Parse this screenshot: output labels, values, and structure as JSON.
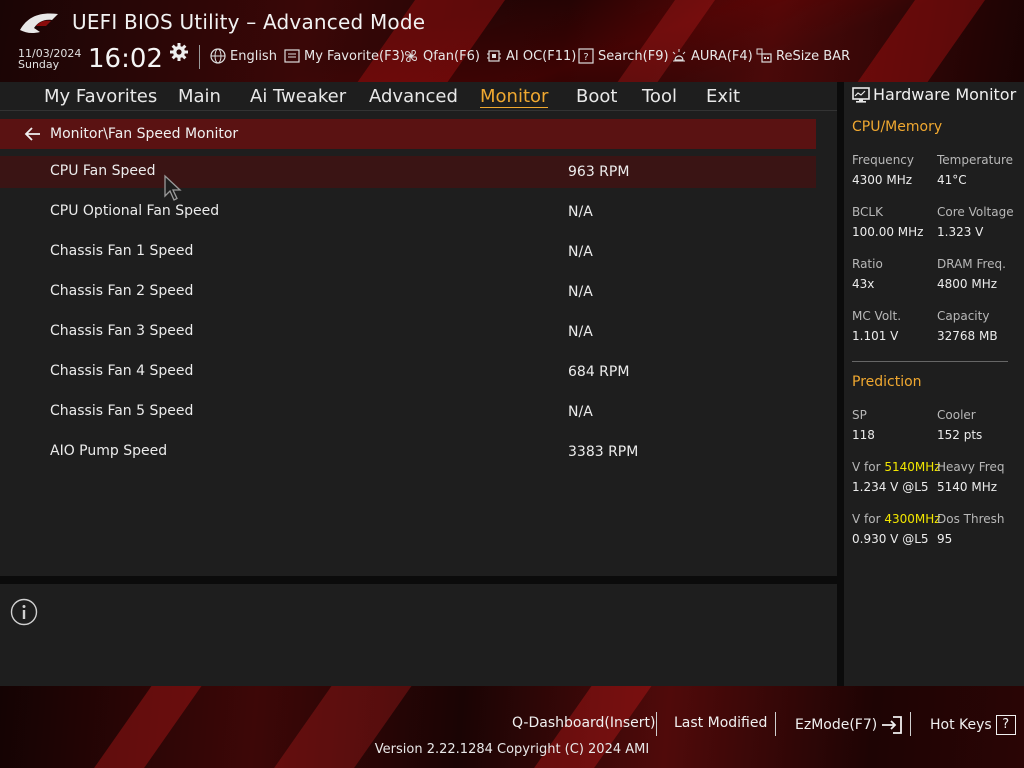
{
  "header": {
    "title": "UEFI BIOS Utility – Advanced Mode",
    "date": "11/03/2024",
    "weekday": "Sunday",
    "time": "16:02",
    "toolbar": [
      {
        "label": "English",
        "icon": "globe-icon"
      },
      {
        "label": "My Favorite(F3)",
        "icon": "favorite-icon"
      },
      {
        "label": "Qfan(F6)",
        "icon": "fan-icon"
      },
      {
        "label": "AI OC(F11)",
        "icon": "ai-oc-icon"
      },
      {
        "label": "Search(F9)",
        "icon": "search-icon"
      },
      {
        "label": "AURA(F4)",
        "icon": "aura-icon"
      },
      {
        "label": "ReSize BAR",
        "icon": "resize-bar-icon"
      }
    ]
  },
  "tabs": [
    {
      "label": "My Favorites"
    },
    {
      "label": "Main"
    },
    {
      "label": "Ai Tweaker"
    },
    {
      "label": "Advanced"
    },
    {
      "label": "Monitor",
      "active": true
    },
    {
      "label": "Boot"
    },
    {
      "label": "Tool"
    },
    {
      "label": "Exit"
    }
  ],
  "breadcrumb": "Monitor\\Fan Speed Monitor",
  "fan_rows": [
    {
      "label": "CPU Fan Speed",
      "value": "963 RPM",
      "selected": true
    },
    {
      "label": "CPU Optional Fan Speed",
      "value": "N/A"
    },
    {
      "label": "Chassis Fan 1 Speed",
      "value": "N/A"
    },
    {
      "label": "Chassis Fan 2 Speed",
      "value": "N/A"
    },
    {
      "label": "Chassis Fan 3 Speed",
      "value": "N/A"
    },
    {
      "label": "Chassis Fan 4 Speed",
      "value": "684 RPM"
    },
    {
      "label": "Chassis Fan 5 Speed",
      "value": "N/A"
    },
    {
      "label": "AIO Pump Speed",
      "value": "3383 RPM"
    }
  ],
  "hardware_monitor": {
    "title": "Hardware Monitor",
    "cpu_memory": {
      "heading": "CPU/Memory",
      "items": [
        {
          "label": "Frequency",
          "value": "4300 MHz"
        },
        {
          "label": "Temperature",
          "value": "41°C"
        },
        {
          "label": "BCLK",
          "value": "100.00 MHz"
        },
        {
          "label": "Core Voltage",
          "value": "1.323 V"
        },
        {
          "label": "Ratio",
          "value": "43x"
        },
        {
          "label": "DRAM Freq.",
          "value": "4800 MHz"
        },
        {
          "label": "MC Volt.",
          "value": "1.101 V"
        },
        {
          "label": "Capacity",
          "value": "32768 MB"
        }
      ]
    },
    "prediction": {
      "heading": "Prediction",
      "sp_label": "SP",
      "sp_value": "118",
      "cooler_label": "Cooler",
      "cooler_value": "152 pts",
      "v1_prefix": "V for ",
      "v1_freq": "5140MHz",
      "v1_value": "1.234 V @L5",
      "heavy_label": "Heavy Freq",
      "heavy_value": "5140 MHz",
      "v2_prefix": "V for ",
      "v2_freq": "4300MHz",
      "v2_value": "0.930 V @L5",
      "dos_label": "Dos Thresh",
      "dos_value": "95"
    }
  },
  "footer": {
    "qdashboard": "Q-Dashboard(Insert)",
    "last_modified": "Last Modified",
    "ezmode": "EzMode(F7)",
    "hotkeys": "Hot Keys",
    "hotkeys_glyph": "?",
    "version": "Version 2.22.1284 Copyright (C) 2024 AMI"
  },
  "colors": {
    "accent": "#f0a830",
    "highlight": "#f2e600",
    "selected_row": "#3a1414",
    "breadcrumb_bg": "#5a1212"
  }
}
